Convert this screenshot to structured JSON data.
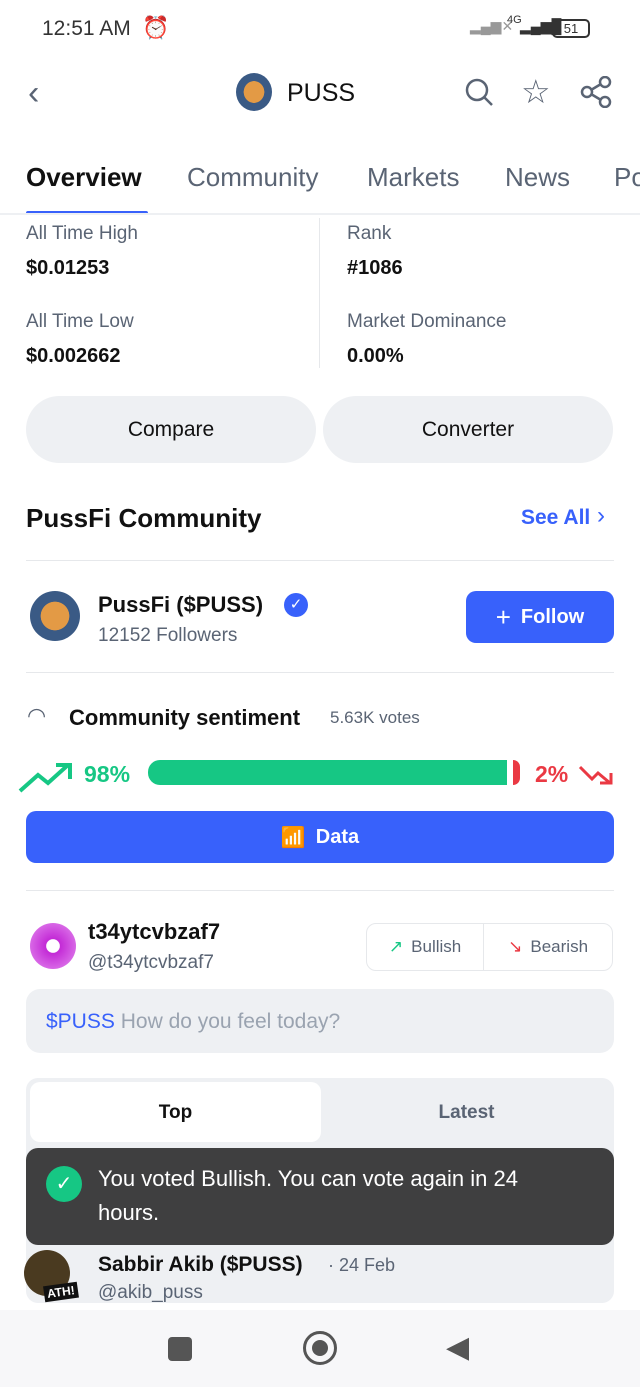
{
  "status": {
    "time": "12:51 AM",
    "network": "4G",
    "battery": "51"
  },
  "header": {
    "title": "PUSS",
    "back_icon": "chevron-left-icon",
    "icons": [
      "search-icon",
      "star-icon",
      "share-icon"
    ]
  },
  "tabs": [
    {
      "label": "Overview",
      "active": true
    },
    {
      "label": "Community"
    },
    {
      "label": "Markets"
    },
    {
      "label": "News"
    },
    {
      "label": "Po"
    }
  ],
  "stats": {
    "ath_label": "All Time High",
    "ath": "$0.01253",
    "rank_label": "Rank",
    "rank": "#1086",
    "atl_label": "All Time Low",
    "atl": "$0.002662",
    "dom_label": "Market Dominance",
    "dom": "0.00%"
  },
  "buttons": {
    "compare": "Compare",
    "converter": "Converter"
  },
  "community": {
    "title": "PussFi Community",
    "see_all": "See All",
    "name": "PussFi ($PUSS)",
    "followers": "12152 Followers",
    "follow": "Follow"
  },
  "sentiment": {
    "title": "Community sentiment",
    "votes": "5.63K votes",
    "bullish_pct": "98%",
    "bearish_pct": "2%",
    "bullish_fraction": 0.98,
    "data_label": "Data",
    "bull_color": "#16c784",
    "bear_color": "#ea3943"
  },
  "user": {
    "name": "t34ytcvbzaf7",
    "handle": "@t34ytcvbzaf7",
    "bullish": "Bullish",
    "bearish": "Bearish"
  },
  "post_input": {
    "ticker": "$PUSS",
    "placeholder": "How do you feel today?"
  },
  "feed_tabs": {
    "top": "Top",
    "latest": "Latest"
  },
  "post": {
    "author": "Sabbir Akib ($PUSS)",
    "date": "· 24 Feb",
    "handle": "@akib_puss",
    "badge": "ATH!"
  },
  "toast": {
    "message": "You voted Bullish. You can vote again in 24 hours."
  }
}
